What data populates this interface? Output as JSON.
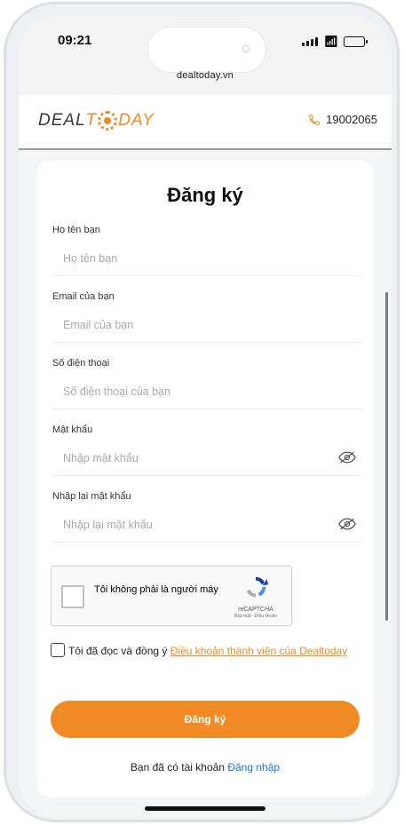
{
  "status": {
    "time": "09:21"
  },
  "browser": {
    "url": "dealtoday.vn"
  },
  "header": {
    "logo": {
      "part1": "DEAL",
      "part2": "T",
      "part3": "DAY"
    },
    "hotline": "19002065"
  },
  "form": {
    "title": "Đăng ký",
    "fields": [
      {
        "label": "Họ tên bạn",
        "placeholder": "Họ tên bạn",
        "value": ""
      },
      {
        "label": "Email của bạn",
        "placeholder": "Email của bạn",
        "value": ""
      },
      {
        "label": "Số điện thoại",
        "placeholder": "Số điện thoại của bạn",
        "value": ""
      },
      {
        "label": "Mật khẩu",
        "placeholder": "Nhập mật khẩu",
        "value": ""
      },
      {
        "label": "Nhập lại mật khẩu",
        "placeholder": "Nhập lại mật khẩu",
        "value": ""
      }
    ],
    "captcha": {
      "label": "Tôi không phải là người máy",
      "brand": "reCAPTCHA",
      "terms": "Bảo mật - Điều khoản"
    },
    "agree": {
      "text": "Tôi đã đọc và đồng ý ",
      "link": "Điều khoản thành viên của Dealtoday"
    },
    "submit_label": "Đăng ký",
    "login": {
      "text": "Bạn đã có tài khoản ",
      "link": "Đăng nhập"
    }
  },
  "colors": {
    "accent": "#f08a24",
    "link": "#1a73e8"
  }
}
